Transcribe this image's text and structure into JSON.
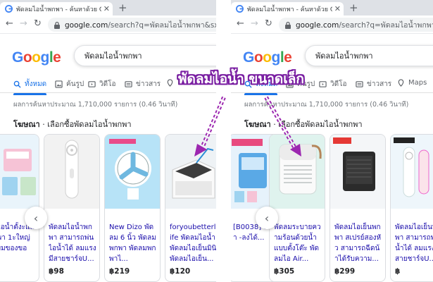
{
  "left": {
    "tab_title": "พัดลมไอน้ำพกพา - ค้นหาด้วย Google",
    "url_host": "google.com",
    "url_path": "/search?q=พัดลมไอน้ำพกพา&sxsrf=ALiCzsaEyo",
    "query": "พัดลมไอน้ำพกพา",
    "tabs": [
      {
        "label": "ทั้งหมด",
        "icon": "search-icon"
      },
      {
        "label": "ค้นรูป",
        "icon": "image-icon"
      },
      {
        "label": "วิดีโอ",
        "icon": "video-icon"
      },
      {
        "label": "ข่าวสาร",
        "icon": "news-icon"
      },
      {
        "label": "M",
        "icon": "maps-icon"
      }
    ],
    "stats": "ผลการค้นหาประมาณ 1,710,000 รายการ (0.46 วินาที)",
    "ad_label": "โฆษณา",
    "ad_title": " · เลือกซื้อพัดลมไอน้ำพกพา",
    "products": [
      {
        "title": "ลมไอน้ำตั้งะแลพกพา 1ะใหญ่ ปรับมของของ...",
        "price": "฿9"
      },
      {
        "title": "พัดลมไอน้ำพกพา สามารถพ่นไอน้ำได้ ลมแรงมีสายชาร์จU...",
        "price": "฿98"
      },
      {
        "title": "New Dizo พัดลม 6 นิ้ว พัดลมพกพา พัดลมพกพาไ...",
        "price": "฿219"
      },
      {
        "title": "foryoubetterlife พัดลมไอน้ำ พัดลมไอเย็นมินิ พัดลมไอเย็น...",
        "price": "฿120"
      }
    ]
  },
  "right": {
    "tab_title": "พัดลมไอน้ำพกพา - ค้นหาด้วย Google",
    "url_host": "google.com",
    "url_path": "/search?q=พัดลมไอน้ำพกพา&sxsrf=ALiCzsaEyo",
    "query": "พัดลมไอน้ำพกพา",
    "tabs": [
      {
        "label": "ทั้งหมด",
        "icon": "search-icon"
      },
      {
        "label": "ค้นรูป",
        "icon": "image-icon"
      },
      {
        "label": "วิดีโอ",
        "icon": "video-icon"
      },
      {
        "label": "ข่าวสาร",
        "icon": "news-icon"
      },
      {
        "label": "Maps",
        "icon": "maps-icon"
      }
    ],
    "stats": "ผลการค้นหาประมาณ 1,710,000 รายการ (0.46 วินาที)",
    "ad_label": "โฆษณา",
    "ad_title": " · เลือกซื้อพัดลมไอน้ำพกพา",
    "products": [
      {
        "title": "[B0038] พกพา -ลงได้...",
        "price": ""
      },
      {
        "title": "พัดลมระบายความร้อนด้วยน้ำ แบบตั้งโต๊ะ พัดลมไอ Air...",
        "price": "฿305"
      },
      {
        "title": "พัดลมไอเย็นพกพา สเปรย์สองหัว สามารถฉีดน้ำได้รับความ...",
        "price": "฿299"
      },
      {
        "title": "พัดลมไอเย็นพกพา สามารถพ่นน้ำได้ ลมแรงมีสายชาร์จU...",
        "price": "฿"
      }
    ]
  },
  "google_letters": [
    "G",
    "o",
    "o",
    "g",
    "l",
    "e"
  ],
  "google_colors": [
    "#4285f4",
    "#ea4335",
    "#fbbc05",
    "#4285f4",
    "#34a853",
    "#ea4335"
  ],
  "callout": "พัดลมไอน้ำ ขนาดเล็ก",
  "callout_color": "#7a1fa2",
  "accent": "#1a73e8",
  "link_color": "#1a0dab"
}
